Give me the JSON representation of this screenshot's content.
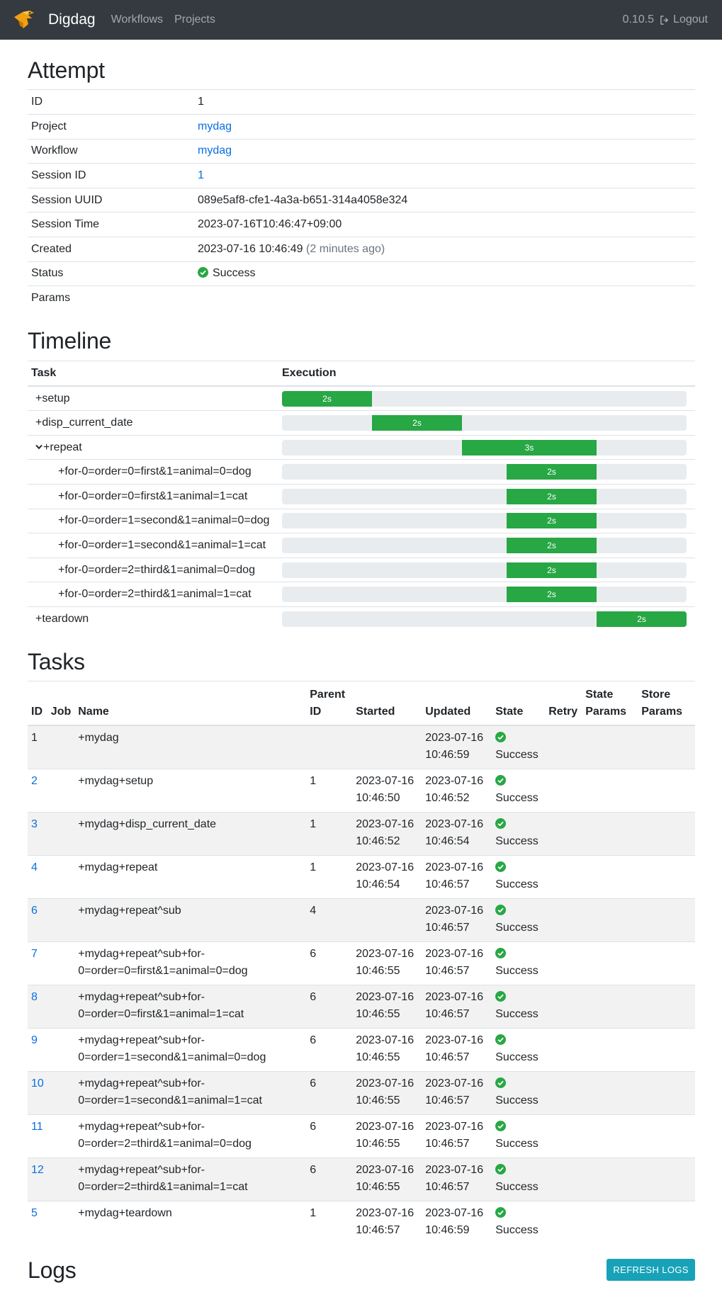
{
  "nav": {
    "brand": "Digdag",
    "links": [
      "Workflows",
      "Projects"
    ],
    "version": "0.10.5",
    "logout": "Logout"
  },
  "attempt": {
    "title": "Attempt",
    "id_label": "ID",
    "id": "1",
    "project_label": "Project",
    "project": "mydag",
    "workflow_label": "Workflow",
    "workflow": "mydag",
    "session_id_label": "Session ID",
    "session_id": "1",
    "session_uuid_label": "Session UUID",
    "session_uuid": "089e5af8-cfe1-4a3a-b651-314a4058e324",
    "session_time_label": "Session Time",
    "session_time": "2023-07-16T10:46:47+09:00",
    "created_label": "Created",
    "created": "2023-07-16 10:46:49",
    "created_ago": "(2 minutes ago)",
    "status_label": "Status",
    "status": "Success",
    "params_label": "Params"
  },
  "timeline": {
    "title": "Timeline",
    "col_task": "Task",
    "col_execution": "Execution",
    "rows": [
      {
        "name": "+setup",
        "duration": "2s",
        "start_fraction": 0.0,
        "end_fraction": 0.222
      },
      {
        "name": "+disp_current_date",
        "duration": "2s",
        "start_fraction": 0.222,
        "end_fraction": 0.444
      },
      {
        "name": "+repeat",
        "duration": "3s",
        "start_fraction": 0.444,
        "end_fraction": 0.778
      },
      {
        "name": "+for-0=order=0=first&1=animal=0=dog",
        "duration": "2s",
        "start_fraction": 0.556,
        "end_fraction": 0.778
      },
      {
        "name": "+for-0=order=0=first&1=animal=1=cat",
        "duration": "2s",
        "start_fraction": 0.556,
        "end_fraction": 0.778
      },
      {
        "name": "+for-0=order=1=second&1=animal=0=dog",
        "duration": "2s",
        "start_fraction": 0.556,
        "end_fraction": 0.778
      },
      {
        "name": "+for-0=order=1=second&1=animal=1=cat",
        "duration": "2s",
        "start_fraction": 0.556,
        "end_fraction": 0.778
      },
      {
        "name": "+for-0=order=2=third&1=animal=0=dog",
        "duration": "2s",
        "start_fraction": 0.556,
        "end_fraction": 0.778
      },
      {
        "name": "+for-0=order=2=third&1=animal=1=cat",
        "duration": "2s",
        "start_fraction": 0.556,
        "end_fraction": 0.778
      },
      {
        "name": "+teardown",
        "duration": "2s",
        "start_fraction": 0.778,
        "end_fraction": 1.0
      }
    ]
  },
  "tasks": {
    "title": "Tasks",
    "headers": {
      "id": "ID",
      "job": "Job",
      "name": "Name",
      "parent1": "Parent",
      "parent2": "ID",
      "started": "Started",
      "updated": "Updated",
      "state": "State",
      "retry": "Retry",
      "state_params1": "State",
      "state_params2": "Params",
      "store_params1": "Store",
      "store_params2": "Params"
    },
    "rows": [
      {
        "id": "1",
        "link": false,
        "name1": "+mydag",
        "name2": "",
        "parent": "",
        "started_date": "",
        "started_time": "",
        "updated_date": "2023-07-16",
        "updated_time": "10:46:59",
        "state": "Success"
      },
      {
        "id": "2",
        "link": true,
        "name1": "+mydag+setup",
        "name2": "",
        "parent": "1",
        "started_date": "2023-07-16",
        "started_time": "10:46:50",
        "updated_date": "2023-07-16",
        "updated_time": "10:46:52",
        "state": "Success"
      },
      {
        "id": "3",
        "link": true,
        "name1": "+mydag+disp_current_date",
        "name2": "",
        "parent": "1",
        "started_date": "2023-07-16",
        "started_time": "10:46:52",
        "updated_date": "2023-07-16",
        "updated_time": "10:46:54",
        "state": "Success"
      },
      {
        "id": "4",
        "link": true,
        "name1": "+mydag+repeat",
        "name2": "",
        "parent": "1",
        "started_date": "2023-07-16",
        "started_time": "10:46:54",
        "updated_date": "2023-07-16",
        "updated_time": "10:46:57",
        "state": "Success"
      },
      {
        "id": "6",
        "link": true,
        "name1": "+mydag+repeat^sub",
        "name2": "",
        "parent": "4",
        "started_date": "",
        "started_time": "",
        "updated_date": "2023-07-16",
        "updated_time": "10:46:57",
        "state": "Success"
      },
      {
        "id": "7",
        "link": true,
        "name1": "+mydag+repeat^sub+for-",
        "name2": "0=order=0=first&1=animal=0=dog",
        "parent": "6",
        "started_date": "2023-07-16",
        "started_time": "10:46:55",
        "updated_date": "2023-07-16",
        "updated_time": "10:46:57",
        "state": "Success"
      },
      {
        "id": "8",
        "link": true,
        "name1": "+mydag+repeat^sub+for-",
        "name2": "0=order=0=first&1=animal=1=cat",
        "parent": "6",
        "started_date": "2023-07-16",
        "started_time": "10:46:55",
        "updated_date": "2023-07-16",
        "updated_time": "10:46:57",
        "state": "Success"
      },
      {
        "id": "9",
        "link": true,
        "name1": "+mydag+repeat^sub+for-",
        "name2": "0=order=1=second&1=animal=0=dog",
        "parent": "6",
        "started_date": "2023-07-16",
        "started_time": "10:46:55",
        "updated_date": "2023-07-16",
        "updated_time": "10:46:57",
        "state": "Success"
      },
      {
        "id": "10",
        "link": true,
        "name1": "+mydag+repeat^sub+for-",
        "name2": "0=order=1=second&1=animal=1=cat",
        "parent": "6",
        "started_date": "2023-07-16",
        "started_time": "10:46:55",
        "updated_date": "2023-07-16",
        "updated_time": "10:46:57",
        "state": "Success"
      },
      {
        "id": "11",
        "link": true,
        "name1": "+mydag+repeat^sub+for-",
        "name2": "0=order=2=third&1=animal=0=dog",
        "parent": "6",
        "started_date": "2023-07-16",
        "started_time": "10:46:55",
        "updated_date": "2023-07-16",
        "updated_time": "10:46:57",
        "state": "Success"
      },
      {
        "id": "12",
        "link": true,
        "name1": "+mydag+repeat^sub+for-",
        "name2": "0=order=2=third&1=animal=1=cat",
        "parent": "6",
        "started_date": "2023-07-16",
        "started_time": "10:46:55",
        "updated_date": "2023-07-16",
        "updated_time": "10:46:57",
        "state": "Success"
      },
      {
        "id": "5",
        "link": true,
        "name1": "+mydag+teardown",
        "name2": "",
        "parent": "1",
        "started_date": "2023-07-16",
        "started_time": "10:46:57",
        "updated_date": "2023-07-16",
        "updated_time": "10:46:59",
        "state": "Success"
      }
    ]
  },
  "logs": {
    "title": "Logs",
    "refresh_label": "REFRESH LOGS"
  },
  "colors": {
    "navbar": "#343a40",
    "success": "#28a745",
    "link": "#0a6fe0",
    "refresh_button": "#17a2b8"
  },
  "icons": {
    "logo": "digdag-bird-logo",
    "logout": "sign-out-icon",
    "status": "check-circle-icon",
    "expand": "chevron-down-icon"
  }
}
